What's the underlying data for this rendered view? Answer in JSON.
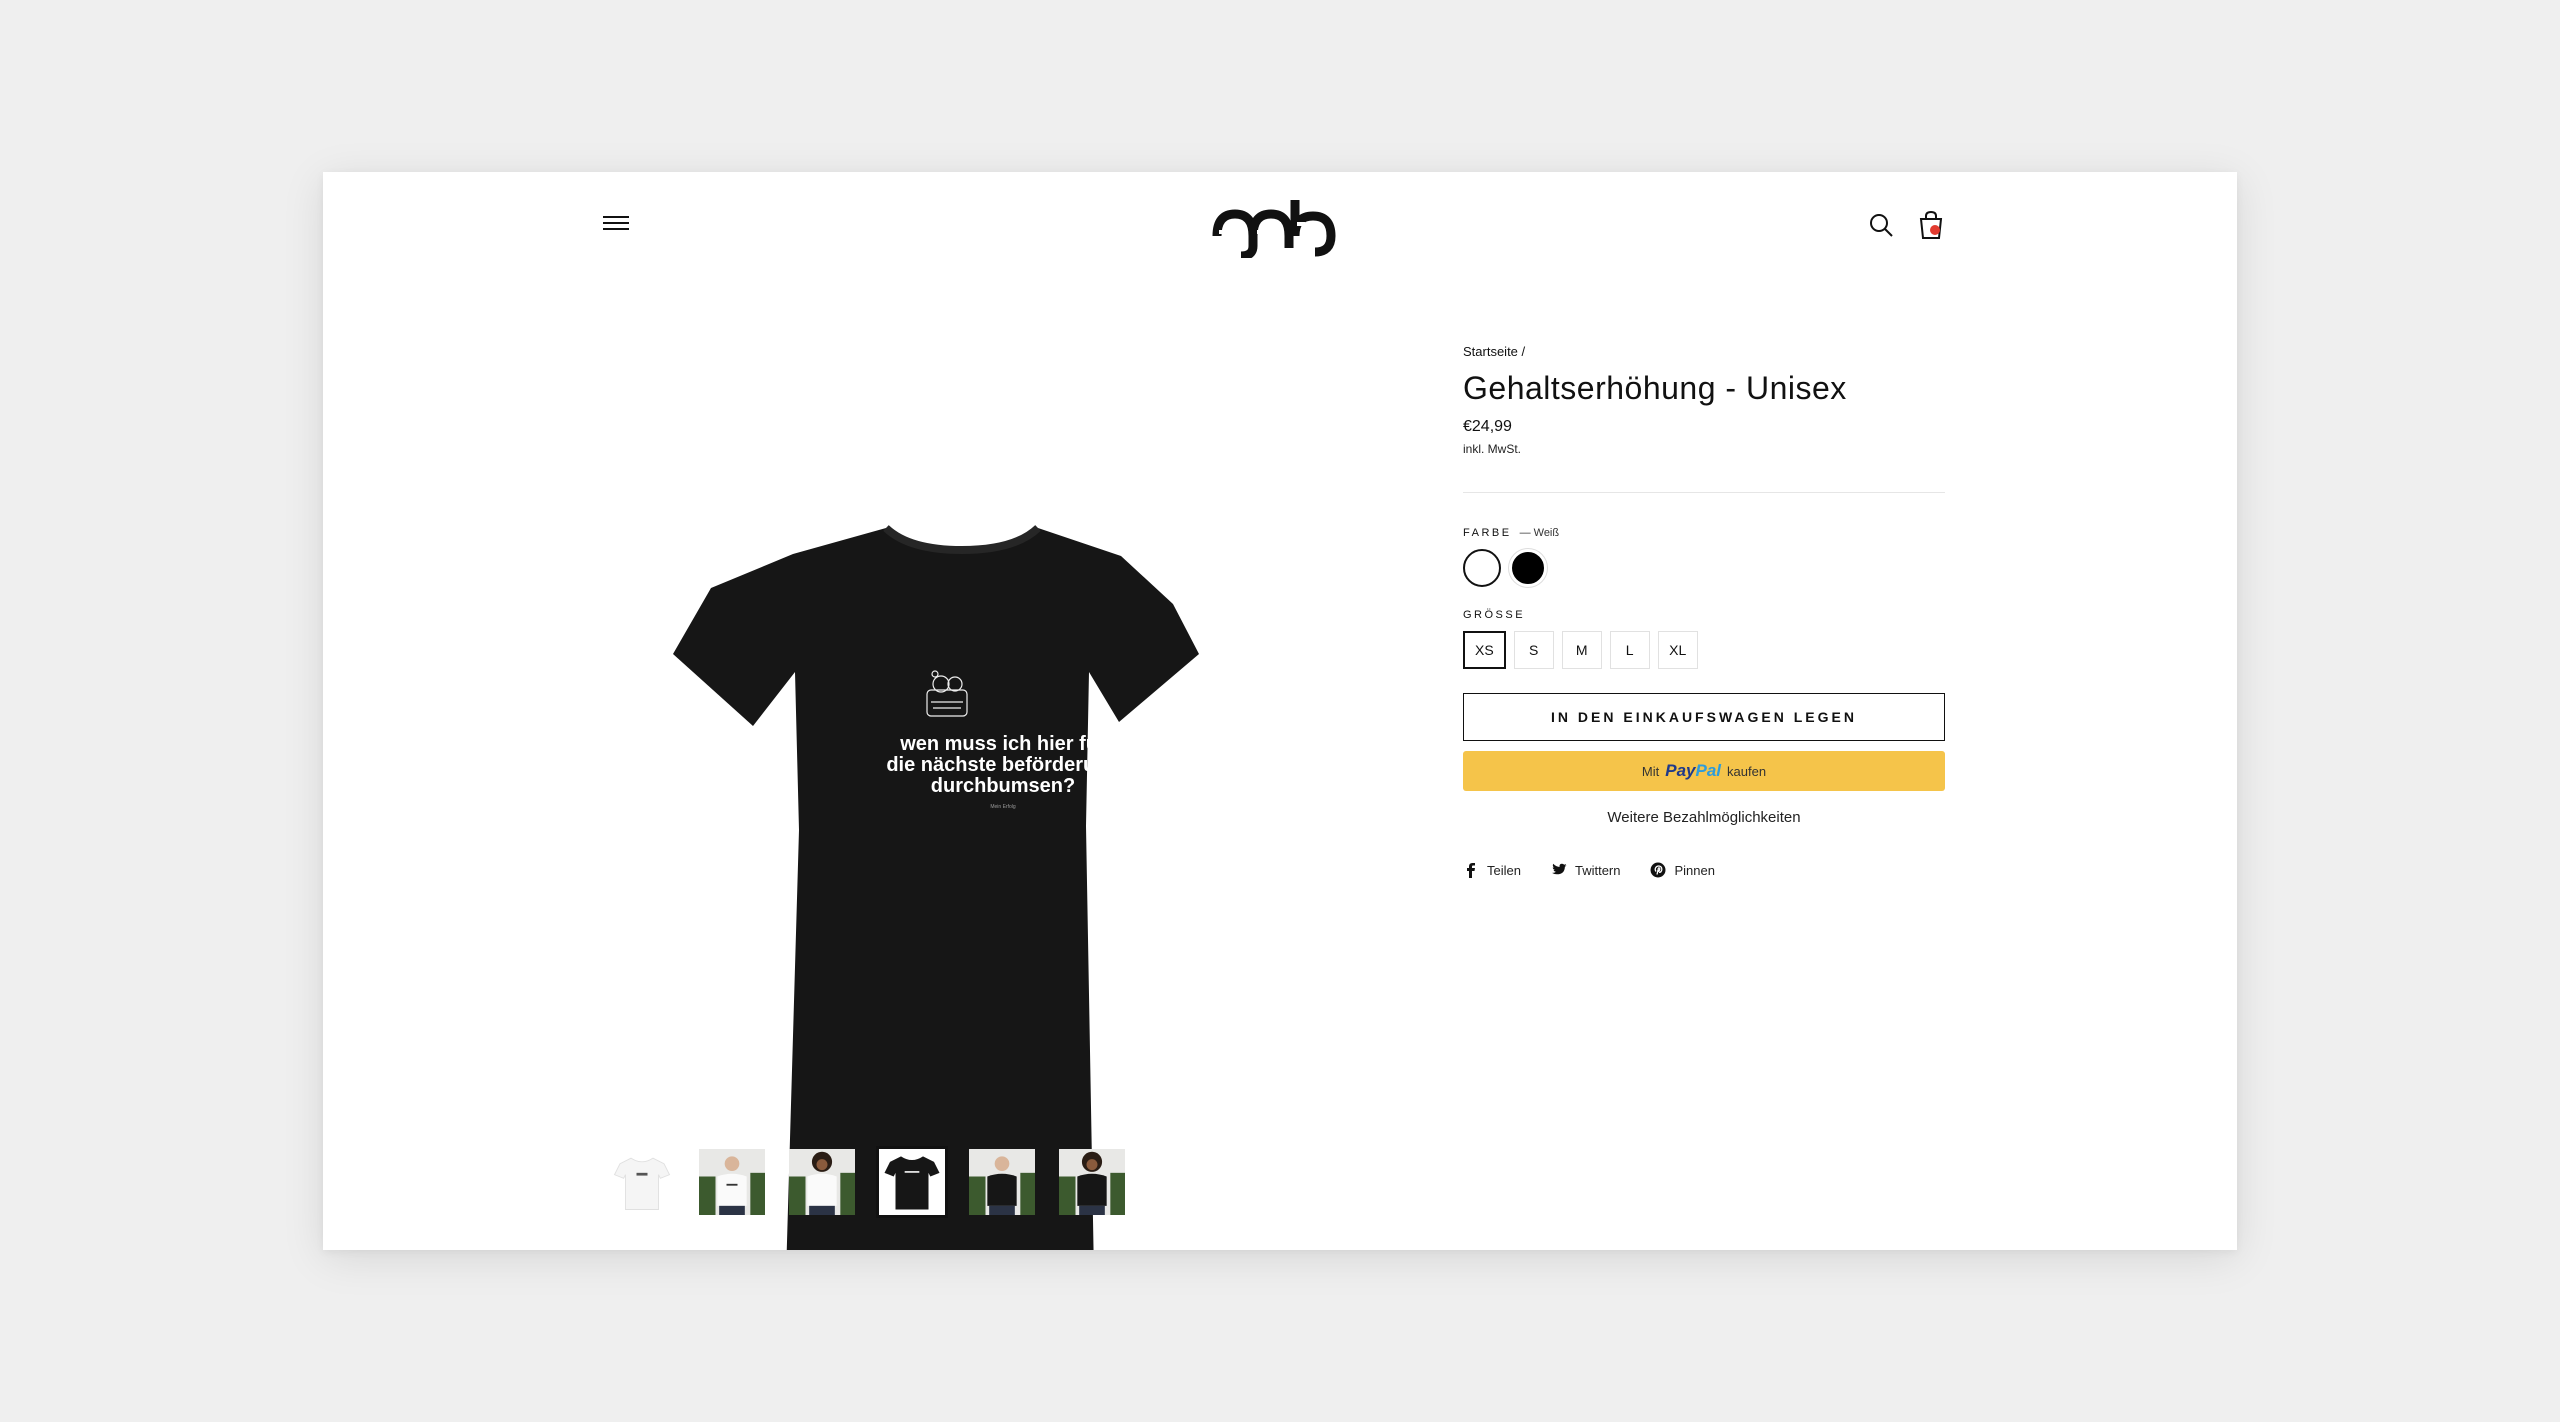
{
  "header": {
    "menu_icon": "hamburger-menu-icon",
    "logo": "gmb-logo",
    "search_icon": "search-icon",
    "cart_icon": "shopping-bag-icon"
  },
  "product": {
    "breadcrumb": "Startseite /",
    "title": "Gehaltserhöhung - Unisex",
    "price": "€24,99",
    "tax_note": "inkl. MwSt.",
    "color_label": "FARBE",
    "color_value": "— Weiß",
    "colors": [
      "#ffffff",
      "#000000"
    ],
    "size_label": "GRÖSSE",
    "sizes": [
      "XS",
      "S",
      "M",
      "L",
      "XL"
    ],
    "selected_size": "XS",
    "add_to_cart": "IN DEN EINKAUFSWAGEN LEGEN",
    "paypal": {
      "prefix": "Mit",
      "brand_1": "Pay",
      "brand_2": "Pal",
      "suffix": "kaufen"
    },
    "more_payment": "Weitere Bezahlmöglichkeiten",
    "share": [
      "Teilen",
      "Twittern",
      "Pinnen"
    ]
  },
  "image": {
    "print_line_1": "wen muss ich hier für",
    "print_line_2": "die nächste beförderung",
    "print_line_3": "durchbumsen?",
    "print_small": "Mein Erfolg"
  },
  "colors": {
    "accent_paypal": "#f5c44a",
    "cart_badge": "#e23b2f",
    "background": "#efefef"
  }
}
